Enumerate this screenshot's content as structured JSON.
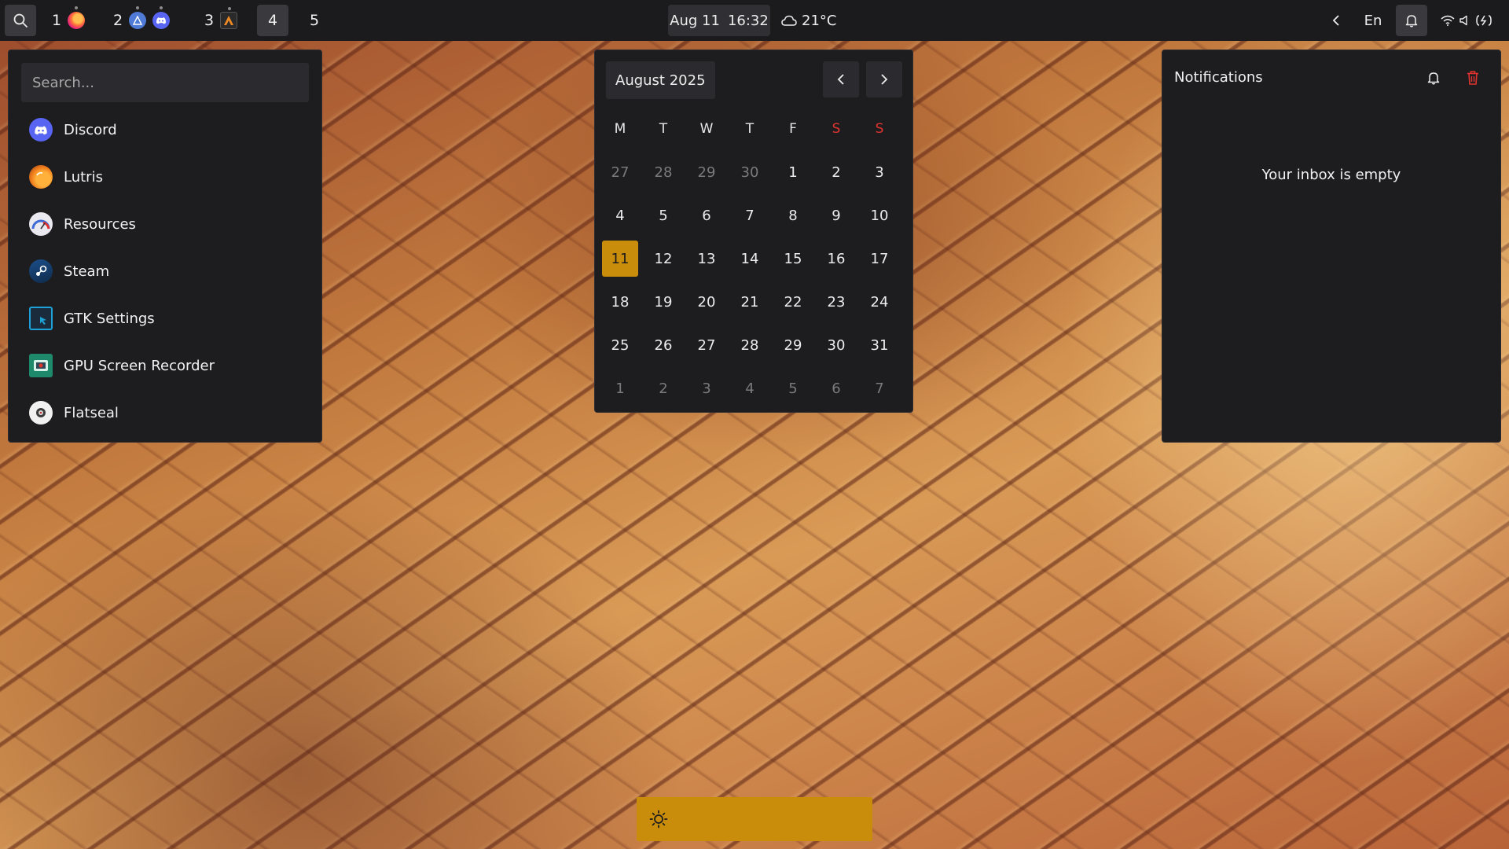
{
  "topbar": {
    "workspaces": [
      {
        "num": "1",
        "icons": [
          "firefox-icon"
        ]
      },
      {
        "num": "2",
        "icons": [
          "arch-icon",
          "discord-icon"
        ]
      },
      {
        "num": "3",
        "icons": [
          "alacritty-icon"
        ]
      },
      {
        "num": "4",
        "icons": []
      },
      {
        "num": "5",
        "icons": []
      }
    ],
    "active_workspace": "4",
    "date": "Aug 11",
    "time": "16:32",
    "weather": "21°C",
    "language": "En"
  },
  "launcher": {
    "search_placeholder": "Search...",
    "apps": [
      {
        "label": "Discord",
        "icon": "discord-icon"
      },
      {
        "label": "Lutris",
        "icon": "lutris-icon"
      },
      {
        "label": "Resources",
        "icon": "resources-icon"
      },
      {
        "label": "Steam",
        "icon": "steam-icon"
      },
      {
        "label": "GTK Settings",
        "icon": "gtk-settings-icon"
      },
      {
        "label": "GPU Screen Recorder",
        "icon": "gpu-screen-recorder-icon"
      },
      {
        "label": "Flatseal",
        "icon": "flatseal-icon"
      }
    ]
  },
  "calendar": {
    "month": "August 2025",
    "weekdays": [
      "M",
      "T",
      "W",
      "T",
      "F",
      "S",
      "S"
    ],
    "weeks": [
      [
        "27",
        "28",
        "29",
        "30",
        "1",
        "2",
        "3"
      ],
      [
        "4",
        "5",
        "6",
        "7",
        "8",
        "9",
        "10"
      ],
      [
        "11",
        "12",
        "13",
        "14",
        "15",
        "16",
        "17"
      ],
      [
        "18",
        "19",
        "20",
        "21",
        "22",
        "23",
        "24"
      ],
      [
        "25",
        "26",
        "27",
        "28",
        "29",
        "30",
        "31"
      ],
      [
        "1",
        "2",
        "3",
        "4",
        "5",
        "6",
        "7"
      ]
    ],
    "today": "11",
    "today_color": "#c98c0b",
    "weekend_color": "#e0342f"
  },
  "notifications": {
    "title": "Notifications",
    "empty_text": "Your inbox is empty",
    "clear_color": "#e0342f"
  },
  "osd": {
    "icon": "brightness-icon",
    "level": 1.0,
    "color": "#c98c0b"
  }
}
